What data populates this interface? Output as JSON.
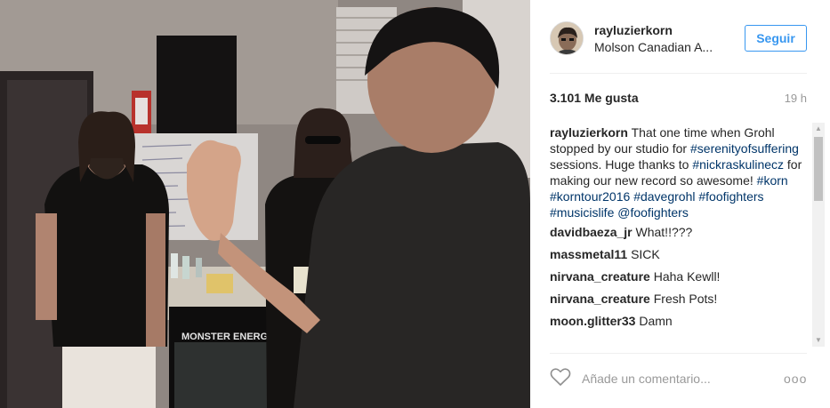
{
  "post": {
    "photo_label": "MONSTER ENERGY",
    "header": {
      "username": "rayluzierkorn",
      "location": "Molson Canadian A...",
      "follow_label": "Seguir"
    },
    "likes": "3.101 Me gusta",
    "time_ago": "19 h",
    "caption": {
      "username": "rayluzierkorn",
      "segments": [
        {
          "text": "That one time when Grohl stopped by our studio for ",
          "link": false
        },
        {
          "text": "#serenityofsuffering",
          "link": true
        },
        {
          "text": " sessions. Huge thanks to ",
          "link": false
        },
        {
          "text": "#nickraskulinecz",
          "link": true
        },
        {
          "text": " for making our new record so awesome! ",
          "link": false
        },
        {
          "text": "#korn",
          "link": true
        },
        {
          "text": " ",
          "link": false
        },
        {
          "text": "#korntour2016",
          "link": true
        },
        {
          "text": " ",
          "link": false
        },
        {
          "text": "#davegrohl",
          "link": true
        },
        {
          "text": " ",
          "link": false
        },
        {
          "text": "#foofighters",
          "link": true
        },
        {
          "text": " ",
          "link": false
        },
        {
          "text": "#musicislife",
          "link": true
        },
        {
          "text": " ",
          "link": false
        },
        {
          "text": "@foofighters",
          "link": true
        }
      ]
    },
    "comments": [
      {
        "user": "davidbaeza_jr",
        "text": "What!!???"
      },
      {
        "user": "massmetal11",
        "text": "SICK"
      },
      {
        "user": "nirvana_creature",
        "text": "Haha Kewll!"
      },
      {
        "user": "nirvana_creature",
        "text": "Fresh Pots!"
      },
      {
        "user": "moon.glitter33",
        "text": "Damn"
      }
    ],
    "comment_placeholder": "Añade un comentario...",
    "more_label": "ooo"
  },
  "icons": {
    "like": "heart-icon",
    "more": "more-options-icon",
    "scroll_up": "scroll-up-arrow-icon",
    "scroll_down": "scroll-down-arrow-icon"
  },
  "colors": {
    "link": "#003569",
    "follow": "#3897f0",
    "muted": "#999999",
    "text": "#262626"
  }
}
